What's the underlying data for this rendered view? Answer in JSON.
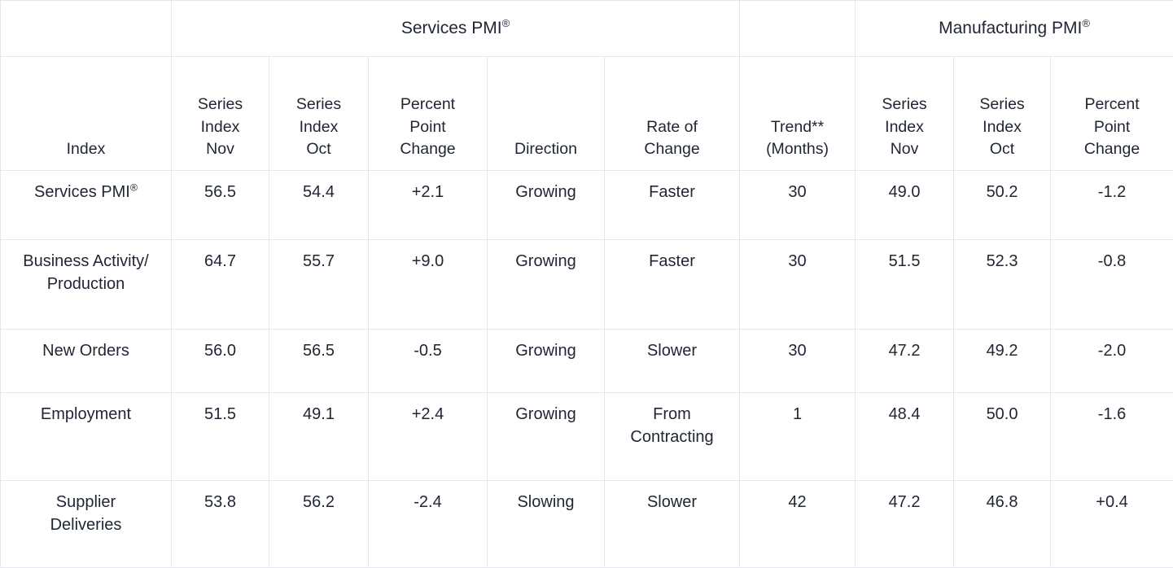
{
  "table": {
    "group_headers": {
      "blank": "",
      "services": "Services PMI",
      "services_sup": "®",
      "manufacturing": "Manufacturing PMI",
      "manufacturing_sup": "®"
    },
    "columns": [
      {
        "id": "index",
        "lines": [
          "Index"
        ]
      },
      {
        "id": "svc_nov",
        "lines": [
          "Series",
          "Index",
          "Nov"
        ]
      },
      {
        "id": "svc_oct",
        "lines": [
          "Series",
          "Index",
          "Oct"
        ]
      },
      {
        "id": "svc_ppc",
        "lines": [
          "Percent",
          "Point",
          "Change"
        ]
      },
      {
        "id": "direction",
        "lines": [
          "Direction"
        ]
      },
      {
        "id": "rate_change",
        "lines": [
          "Rate of",
          "Change"
        ]
      },
      {
        "id": "trend",
        "lines": [
          "Trend**",
          "(Months)"
        ]
      },
      {
        "id": "mfg_nov",
        "lines": [
          "Series",
          "Index",
          "Nov"
        ]
      },
      {
        "id": "mfg_oct",
        "lines": [
          "Series",
          "Index",
          "Oct"
        ]
      },
      {
        "id": "mfg_ppc",
        "lines": [
          "Percent",
          "Point",
          "Change"
        ]
      }
    ],
    "rows": [
      {
        "index_lines": [
          "Services PMI"
        ],
        "index_sup": "®",
        "svc_nov": "56.5",
        "svc_oct": "54.4",
        "svc_ppc": "+2.1",
        "direction": [
          "Growing"
        ],
        "rate_change": [
          "Faster"
        ],
        "trend": "30",
        "mfg_nov": "49.0",
        "mfg_oct": "50.2",
        "mfg_ppc": "-1.2"
      },
      {
        "index_lines": [
          "Business Activity/",
          "Production"
        ],
        "index_sup": "",
        "svc_nov": "64.7",
        "svc_oct": "55.7",
        "svc_ppc": "+9.0",
        "direction": [
          "Growing"
        ],
        "rate_change": [
          "Faster"
        ],
        "trend": "30",
        "mfg_nov": "51.5",
        "mfg_oct": "52.3",
        "mfg_ppc": "-0.8"
      },
      {
        "index_lines": [
          "New Orders"
        ],
        "index_sup": "",
        "svc_nov": "56.0",
        "svc_oct": "56.5",
        "svc_ppc": "-0.5",
        "direction": [
          "Growing"
        ],
        "rate_change": [
          "Slower"
        ],
        "trend": "30",
        "mfg_nov": "47.2",
        "mfg_oct": "49.2",
        "mfg_ppc": "-2.0"
      },
      {
        "index_lines": [
          "Employment"
        ],
        "index_sup": "",
        "svc_nov": "51.5",
        "svc_oct": "49.1",
        "svc_ppc": "+2.4",
        "direction": [
          "Growing"
        ],
        "rate_change": [
          "From",
          "Contracting"
        ],
        "trend": "1",
        "mfg_nov": "48.4",
        "mfg_oct": "50.0",
        "mfg_ppc": "-1.6"
      },
      {
        "index_lines": [
          "Supplier",
          "Deliveries"
        ],
        "index_sup": "",
        "svc_nov": "53.8",
        "svc_oct": "56.2",
        "svc_ppc": "-2.4",
        "direction": [
          "Slowing"
        ],
        "rate_change": [
          "Slower"
        ],
        "trend": "42",
        "mfg_nov": "47.2",
        "mfg_oct": "46.8",
        "mfg_ppc": "+0.4"
      }
    ]
  },
  "colors": {
    "text": "#1f2533",
    "border": "#e4e6eb",
    "background": "#ffffff"
  }
}
